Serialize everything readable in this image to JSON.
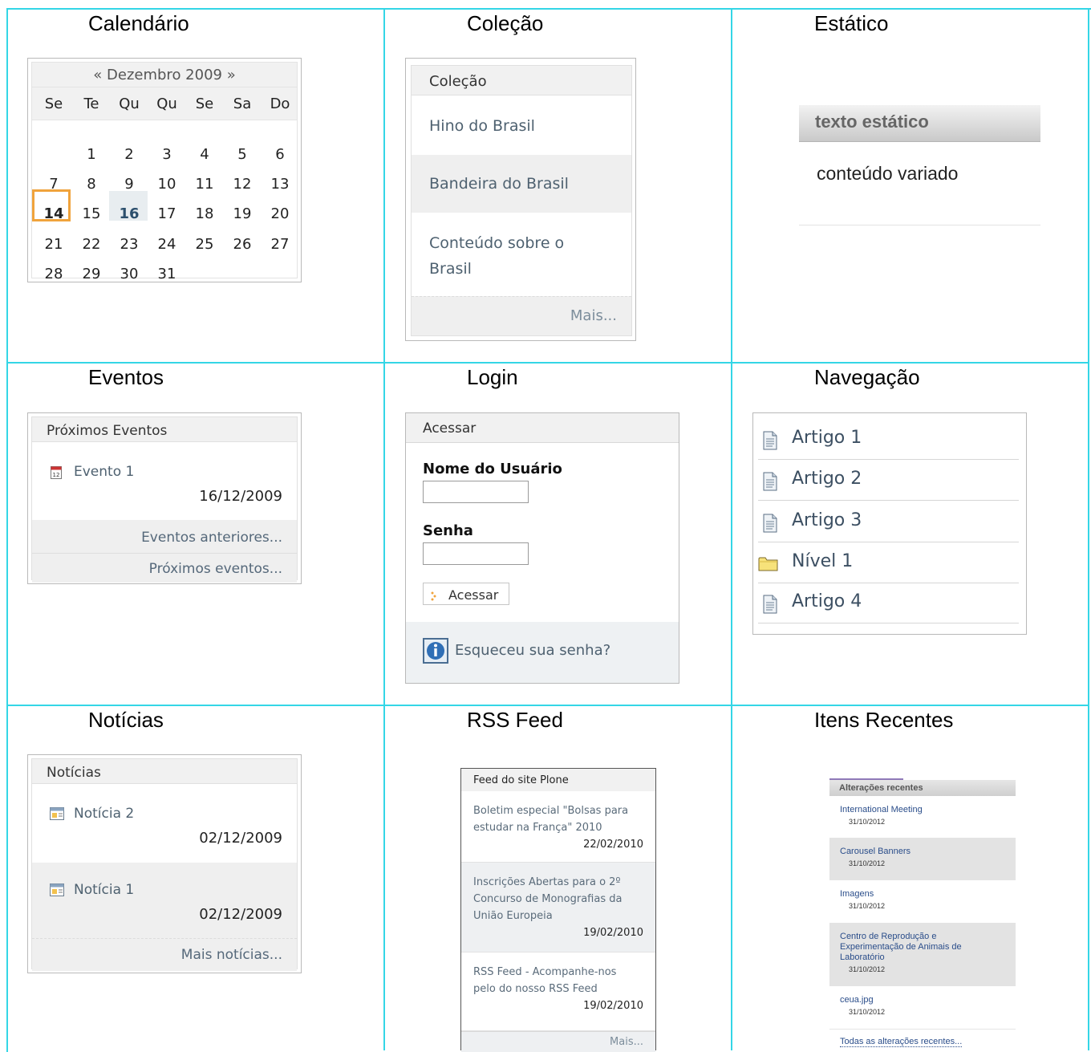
{
  "titles": {
    "calendar": "Calendário",
    "collection": "Coleção",
    "static": "Estático",
    "events": "Eventos",
    "login": "Login",
    "navigation": "Navegação",
    "news": "Notícias",
    "rss": "RSS Feed",
    "recent": "Itens Recentes"
  },
  "calendar": {
    "prev": "«",
    "month": "Dezembro 2009",
    "next": "»",
    "weekdays": [
      "Se",
      "Te",
      "Qu",
      "Qu",
      "Se",
      "Sa",
      "Do"
    ],
    "weeks": [
      [
        "",
        "1",
        "2",
        "3",
        "4",
        "5",
        "6"
      ],
      [
        "7",
        "8",
        "9",
        "10",
        "11",
        "12",
        "13"
      ],
      [
        "14",
        "15",
        "16",
        "17",
        "18",
        "19",
        "20"
      ],
      [
        "21",
        "22",
        "23",
        "24",
        "25",
        "26",
        "27"
      ],
      [
        "28",
        "29",
        "30",
        "31",
        "",
        "",
        ""
      ]
    ],
    "today": "14",
    "highlight": "16",
    "today_color": "#f0a33c"
  },
  "collection": {
    "header": "Coleção",
    "items": [
      "Hino do Brasil",
      "Bandeira do Brasil",
      "Conteúdo sobre o",
      "Brasil"
    ],
    "more": "Mais..."
  },
  "static": {
    "header": "texto estático",
    "body": "conteúdo variado"
  },
  "events": {
    "header": "Próximos Eventos",
    "item": "Evento 1",
    "date": "16/12/2009",
    "previous": "Eventos anteriores...",
    "upcoming": "Próximos eventos..."
  },
  "login": {
    "header": "Acessar",
    "user_label": "Nome do Usuário",
    "user_value": "",
    "pass_label": "Senha",
    "pass_value": "",
    "button": "Acessar",
    "forgot": "Esqueceu sua senha?"
  },
  "navigation": {
    "items": [
      {
        "label": "Artigo 1",
        "icon": "document-icon"
      },
      {
        "label": "Artigo 2",
        "icon": "document-icon"
      },
      {
        "label": "Artigo 3",
        "icon": "document-icon"
      },
      {
        "label": "Nível 1",
        "icon": "folder-icon"
      },
      {
        "label": "Artigo 4",
        "icon": "document-icon"
      }
    ]
  },
  "news": {
    "header": "Notícias",
    "items": [
      {
        "title": "Notícia 2",
        "date": "02/12/2009"
      },
      {
        "title": "Notícia 1",
        "date": "02/12/2009"
      }
    ],
    "more": "Mais notícias..."
  },
  "rss": {
    "header": "Feed do site Plone",
    "items": [
      {
        "lines": [
          "Boletim especial \"Bolsas para",
          "estudar na França\" 2010"
        ],
        "date": "22/02/2010"
      },
      {
        "lines": [
          "Inscrições Abertas para o 2º",
          "Concurso de Monografias da",
          "União Europeia"
        ],
        "date": "19/02/2010"
      },
      {
        "lines": [
          "RSS Feed - Acompanhe-nos",
          "pelo do nosso RSS Feed"
        ],
        "date": "19/02/2010"
      }
    ],
    "more": "Mais..."
  },
  "recent": {
    "header": "Alterações recentes",
    "items": [
      {
        "lines": [
          "International Meeting"
        ],
        "date": "31/10/2012"
      },
      {
        "lines": [
          "Carousel Banners"
        ],
        "date": "31/10/2012"
      },
      {
        "lines": [
          "Imagens"
        ],
        "date": "31/10/2012"
      },
      {
        "lines": [
          "Centro de Reprodução e",
          "Experimentação de Animais de",
          "Laboratório"
        ],
        "date": "31/10/2012"
      },
      {
        "lines": [
          "ceua.jpg"
        ],
        "date": "31/10/2012"
      }
    ],
    "all": "Todas as alterações recentes..."
  }
}
